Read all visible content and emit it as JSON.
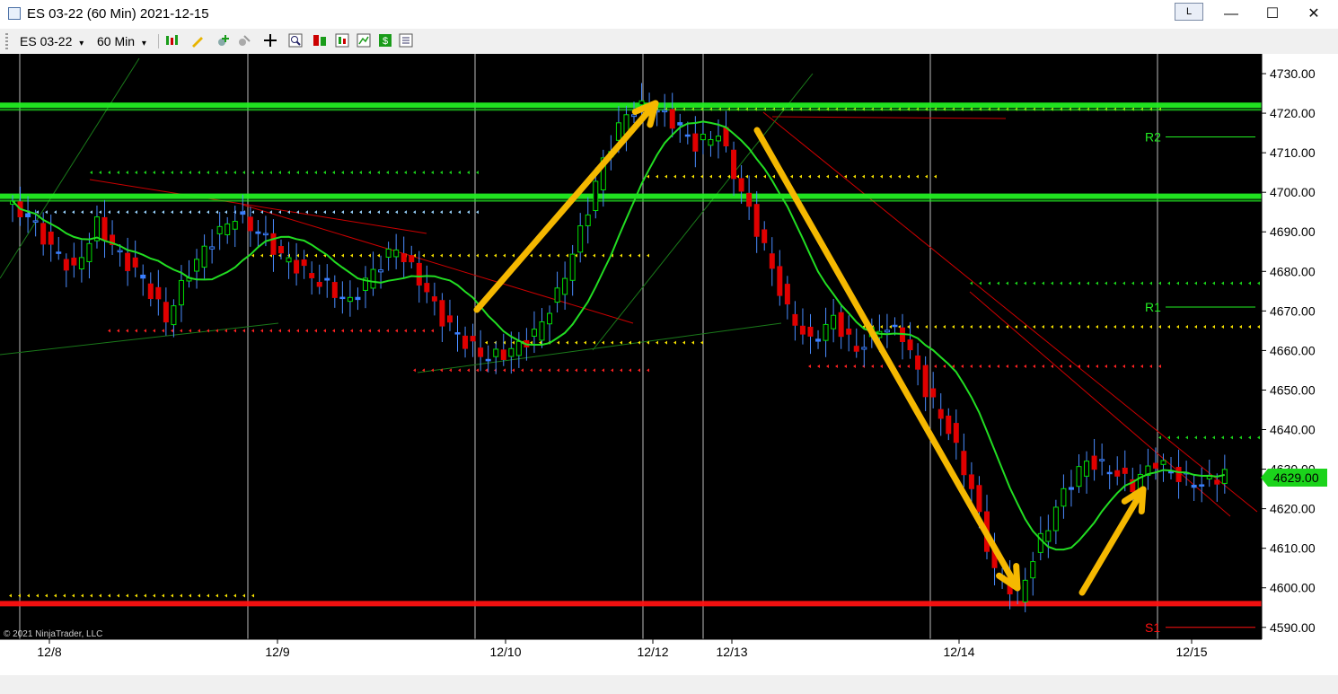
{
  "window": {
    "title": "ES 03-22 (60 Min)  2021-12-15",
    "lock_label": "L",
    "minimize_glyph": "—",
    "maximize_glyph": "☐",
    "close_glyph": "✕"
  },
  "toolbar": {
    "instrument": "ES 03-22",
    "interval": "60 Min",
    "dropdown_glyph": "▾"
  },
  "chart": {
    "copyright": "© 2021 NinjaTrader, LLC",
    "current_price_label": "4629.00",
    "pivot_labels": [
      "R2",
      "R1",
      "S1"
    ],
    "colors": {
      "background": "#000000",
      "up_candle": "#00e000",
      "down_candle": "#e00000",
      "neutral_candle": "#3a7fff",
      "moving_average": "#22dd22",
      "support_resistance_green": "#22ee22",
      "support_red": "#ff1111",
      "annotation_arrow": "#f5b800",
      "trendline": "#cc0000"
    }
  },
  "chart_data": {
    "type": "candlestick",
    "ylim": [
      4587,
      4735
    ],
    "y_ticks": [
      "4730.00",
      "4720.00",
      "4710.00",
      "4700.00",
      "4690.00",
      "4680.00",
      "4670.00",
      "4660.00",
      "4650.00",
      "4640.00",
      "4630.00",
      "4620.00",
      "4610.00",
      "4600.00",
      "4590.00"
    ],
    "x_tick_labels": [
      "12/8",
      "12/9",
      "12/10",
      "12/12",
      "12/13",
      "12/14",
      "12/15"
    ],
    "horizontal_levels": [
      {
        "price": 4722,
        "color": "green",
        "kind": "resistance"
      },
      {
        "price": 4699,
        "color": "green",
        "kind": "resistance"
      },
      {
        "price": 4596,
        "color": "red",
        "kind": "support"
      }
    ],
    "pivots": [
      {
        "label": "R2",
        "price": 4714
      },
      {
        "label": "R1",
        "price": 4671
      },
      {
        "label": "S1",
        "price": 4590
      }
    ],
    "last_price": 4629,
    "price_path": [
      4697,
      4694,
      4686,
      4680,
      4692,
      4684,
      4678,
      4668,
      4680,
      4688,
      4694,
      4690,
      4684,
      4680,
      4676,
      4672,
      4680,
      4686,
      4678,
      4668,
      4662,
      4658,
      4660,
      4664,
      4674,
      4690,
      4708,
      4720,
      4722,
      4718,
      4712,
      4715,
      4700,
      4686,
      4670,
      4662,
      4668,
      4660,
      4666,
      4664,
      4650,
      4640,
      4625,
      4604,
      4598,
      4612,
      4624,
      4632,
      4630,
      4626,
      4632,
      4628,
      4626,
      4629
    ]
  }
}
